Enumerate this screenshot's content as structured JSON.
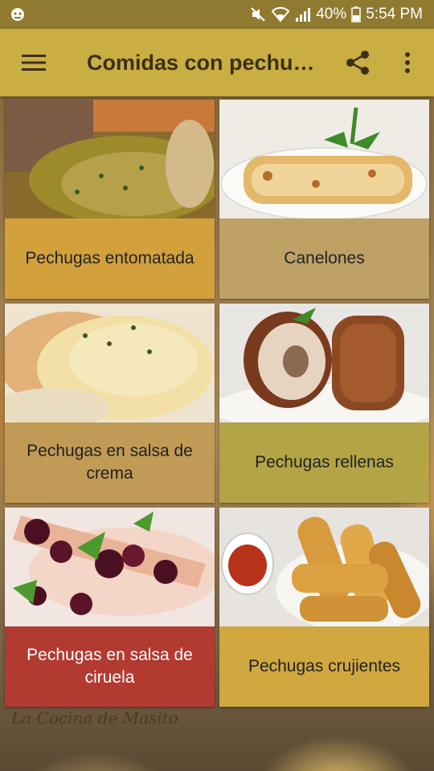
{
  "status_bar": {
    "battery": "40%",
    "time": "5:54 PM"
  },
  "app_bar": {
    "title": "Comidas con pechuga de pollo",
    "menu_icon": "hamburger-menu-icon",
    "share_icon": "share-icon",
    "more_icon": "more-vert-icon",
    "color": "#c9ae44"
  },
  "cards": [
    {
      "label": "Pechugas entomatada",
      "color": "#d2a13c"
    },
    {
      "label": "Canelones",
      "color": "#bfa166"
    },
    {
      "label": "Pechugas en salsa de crema",
      "color": "#c19a55"
    },
    {
      "label": "Pechugas rellenas",
      "color": "#b3a445"
    },
    {
      "label": "Pechugas en salsa de ciruela",
      "color": "#b23a31"
    },
    {
      "label": "Pechugas crujientes",
      "color": "#d1a73f"
    }
  ],
  "footer": {
    "watermark": "La Cocina de Masito"
  }
}
